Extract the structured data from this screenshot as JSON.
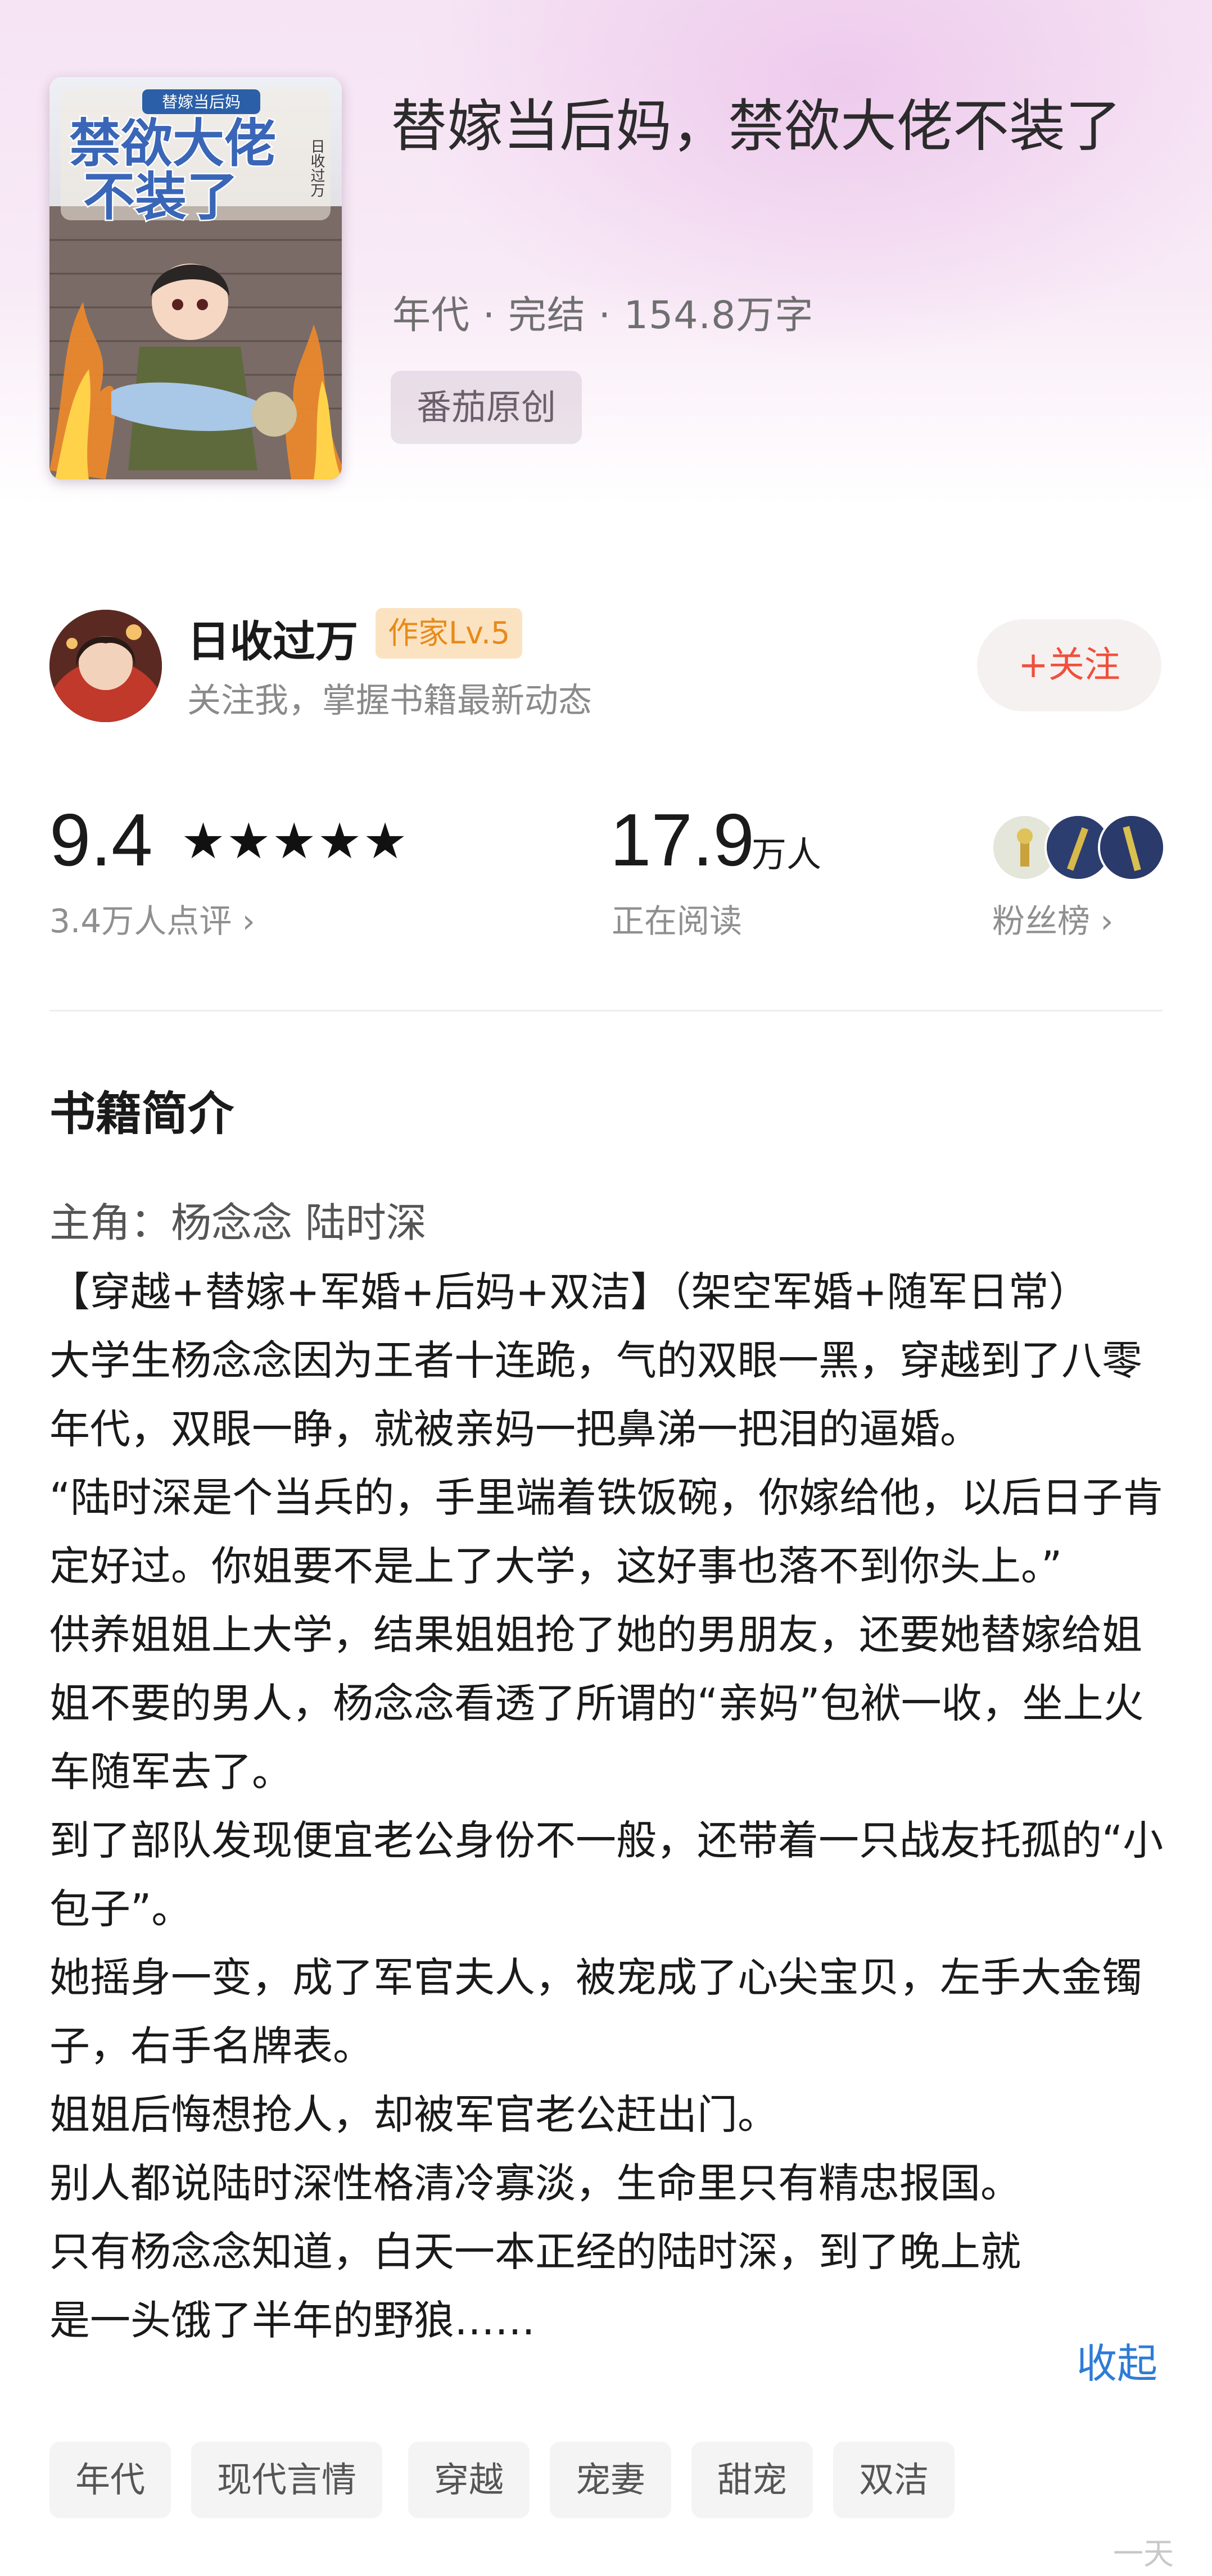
{
  "book": {
    "title": "替嫁当后妈，禁欲大佬不装了",
    "meta": "年代 · 完结 · 154.8万字",
    "source": "番茄原创",
    "cover": {
      "title_line1": "禁欲大佬",
      "title_line2": "不装了",
      "subtitle": "替嫁当后妈",
      "author": "日收过万"
    }
  },
  "author": {
    "name": "日收过万",
    "level": "作家Lv.5",
    "hint": "关注我，掌握书籍最新动态",
    "follow_label": "+关注"
  },
  "stats": {
    "rating": "9.4",
    "stars": "★★★★★",
    "reviews": "3.4万人点评 ›",
    "readers": "17.9",
    "readers_unit": "万人",
    "readers_label": "正在阅读",
    "fans_label": "粉丝榜 ›"
  },
  "intro": {
    "section_title": "书籍简介",
    "protagonists": "主角：杨念念 陆时深",
    "paragraphs": [
      "【穿越+替嫁+军婚+后妈+双洁】（架空军婚+随军日常）",
      "大学生杨念念因为王者十连跪，气的双眼一黑，穿越到了八零年代，双眼一睁，就被亲妈一把鼻涕一把泪的逼婚。",
      "“陆时深是个当兵的，手里端着铁饭碗，你嫁给他，以后日子肯定好过。你姐要不是上了大学，这好事也落不到你头上。”",
      "供养姐姐上大学，结果姐姐抢了她的男朋友，还要她替嫁给姐姐不要的男人，杨念念看透了所谓的“亲妈”包袱一收，坐上火车随军去了。",
      "到了部队发现便宜老公身份不一般，还带着一只战友托孤的“小包子”。",
      "她摇身一变，成了军官夫人，被宠成了心尖宝贝，左手大金镯子，右手名牌表。",
      "姐姐后悔想抢人，却被军官老公赶出门。",
      "别人都说陆时深性格清冷寡淡，生命里只有精忠报国。",
      "只有杨念念知道，白天一本正经的陆时深，到了晚上就是一头饿了半年的野狼……"
    ],
    "collapse_label": "收起"
  },
  "tags": [
    "年代",
    "现代言情",
    "穿越",
    "宠妻",
    "甜宠",
    "双洁"
  ],
  "watermark": "一天",
  "colors": {
    "accent": "#f0503c",
    "link": "#2e7bd6",
    "level_badge_bg": "#fbe3c2",
    "level_badge_fg": "#e88a1a"
  }
}
